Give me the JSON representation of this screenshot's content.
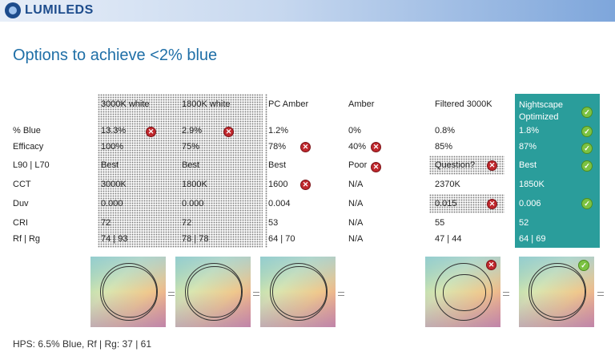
{
  "brand": {
    "name": "LUMILEDS"
  },
  "title": "Options to achieve <2% blue",
  "columns": [
    "3000K white",
    "1800K white",
    "PC Amber",
    "Amber",
    "Filtered 3000K",
    "Nightscape Optimized"
  ],
  "rows": [
    {
      "label": "% Blue",
      "values": [
        "13.3%",
        "2.9%",
        "1.2%",
        "0%",
        "0.8%",
        "1.8%"
      ]
    },
    {
      "label": "Efficacy",
      "values": [
        "100%",
        "75%",
        "78%",
        "40%",
        "85%",
        "87%"
      ]
    },
    {
      "label": "L90 | L70",
      "values": [
        "Best",
        "Best",
        "Best",
        "Poor",
        "Question?",
        "Best"
      ]
    },
    {
      "label": "CCT",
      "values": [
        "3000K",
        "1800K",
        "1600",
        "N/A",
        "2370K",
        "1850K"
      ]
    },
    {
      "label": "Duv",
      "values": [
        "0.000",
        "0.000",
        "0.004",
        "N/A",
        "0.015",
        "0.006"
      ]
    },
    {
      "label": "CRI",
      "values": [
        "72",
        "72",
        "53",
        "N/A",
        "55",
        "52"
      ]
    },
    {
      "label": "Rf | Rg",
      "values": [
        "74 | 93",
        "78 | 78",
        "64 | 70",
        "N/A",
        "47 | 44",
        "64 | 69"
      ]
    }
  ],
  "icons": {
    "fail": "x-circle-icon",
    "pass": "check-circle-icon"
  },
  "colors": {
    "title": "#1f6fa7",
    "highlight": "#2a9d9b",
    "fail": "#c0282d",
    "pass": "#7cc242"
  },
  "footer": "HPS: 6.5% Blue, Rf | Rg: 37 | 61"
}
